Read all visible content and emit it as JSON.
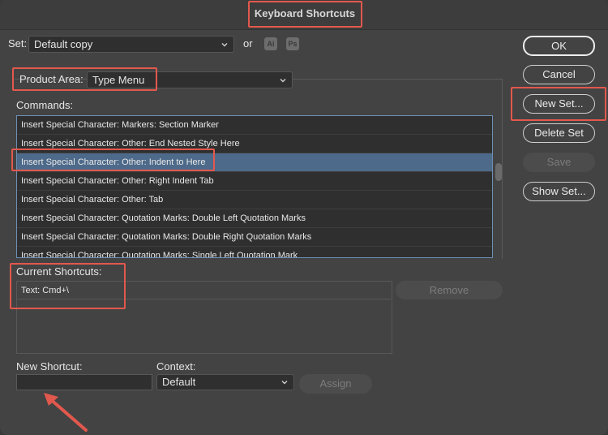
{
  "window": {
    "title": "Keyboard Shortcuts"
  },
  "set": {
    "label": "Set:",
    "value": "Default copy",
    "or_label": "or",
    "app_icons": [
      "Ai",
      "Ps"
    ]
  },
  "product_area": {
    "label": "Product Area:",
    "value": "Type Menu"
  },
  "commands": {
    "label": "Commands:",
    "items": [
      "Insert Special Character: Markers: Section Marker",
      "Insert Special Character: Other: End Nested Style Here",
      "Insert Special Character: Other: Indent to Here",
      "Insert Special Character: Other: Right Indent Tab",
      "Insert Special Character: Other: Tab",
      "Insert Special Character: Quotation Marks: Double Left Quotation Marks",
      "Insert Special Character: Quotation Marks: Double Right Quotation Marks",
      "Insert Special Character: Quotation Marks: Single Left Quotation Mark"
    ],
    "selected_index": 2
  },
  "current_shortcuts": {
    "label": "Current Shortcuts:",
    "items": [
      "Text: Cmd+\\"
    ]
  },
  "buttons": {
    "ok": "OK",
    "cancel": "Cancel",
    "new_set": "New Set...",
    "delete_set": "Delete Set",
    "save": "Save",
    "show_set": "Show Set...",
    "remove": "Remove",
    "assign": "Assign"
  },
  "new_shortcut": {
    "label": "New Shortcut:",
    "value": ""
  },
  "context": {
    "label": "Context:",
    "value": "Default"
  },
  "colors": {
    "highlight": "#e2584d",
    "selection": "#4d6a8a",
    "focus_border": "#6e8fb6"
  }
}
